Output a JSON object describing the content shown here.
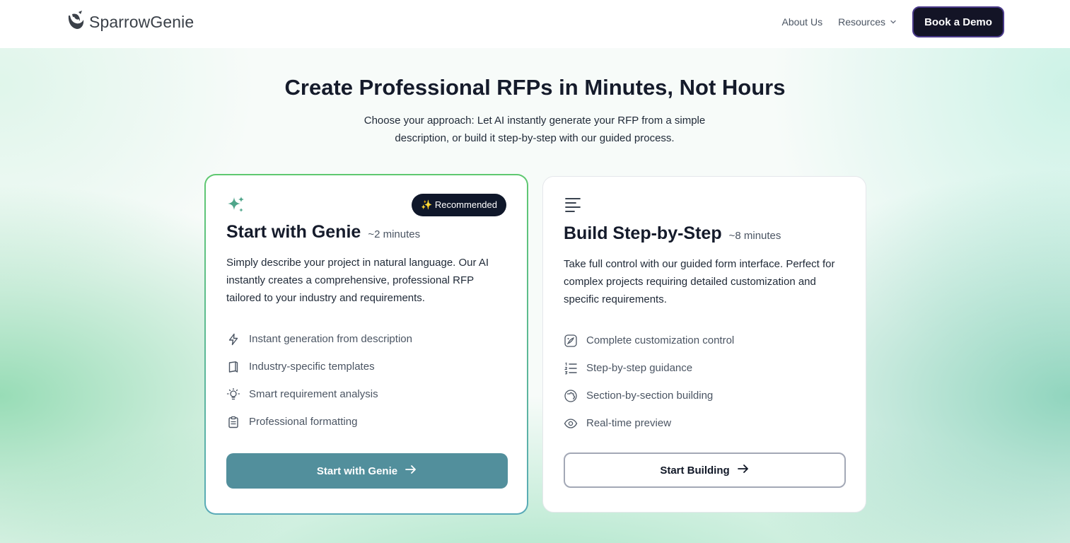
{
  "header": {
    "brand": "SparrowGenie",
    "nav": {
      "about": "About Us",
      "resources": "Resources"
    },
    "cta": "Book a Demo"
  },
  "hero": {
    "title": "Create Professional RFPs in Minutes, Not Hours",
    "subtitle": "Choose your approach: Let AI instantly generate your RFP from a simple description, or build it step-by-step with our guided process."
  },
  "cards": [
    {
      "icon": "sparkles-icon",
      "badge": "✨ Recommended",
      "title": "Start with Genie",
      "time": "~2 minutes",
      "description": "Simply describe your project in natural language. Our AI instantly creates a comprehensive, professional RFP tailored to your industry and requirements.",
      "features": [
        {
          "icon": "lightning-icon",
          "label": "Instant generation from description"
        },
        {
          "icon": "book-icon",
          "label": "Industry-specific templates"
        },
        {
          "icon": "lightbulb-icon",
          "label": "Smart requirement analysis"
        },
        {
          "icon": "clipboard-icon",
          "label": "Professional formatting"
        }
      ],
      "button": "Start with Genie"
    },
    {
      "icon": "align-left-icon",
      "title": "Build Step-by-Step",
      "time": "~8 minutes",
      "description": "Take full control with our guided form interface. Perfect for complex projects requiring detailed customization and specific requirements.",
      "features": [
        {
          "icon": "palette-icon",
          "label": "Complete customization control"
        },
        {
          "icon": "numbered-list-icon",
          "label": "Step-by-step guidance"
        },
        {
          "icon": "puzzle-icon",
          "label": "Section-by-section building"
        },
        {
          "icon": "eye-icon",
          "label": "Real-time preview"
        }
      ],
      "button": "Start Building"
    }
  ],
  "colors": {
    "primary_button": "#528f9c",
    "dark": "#131426",
    "genie_accent": "#5fc870"
  }
}
